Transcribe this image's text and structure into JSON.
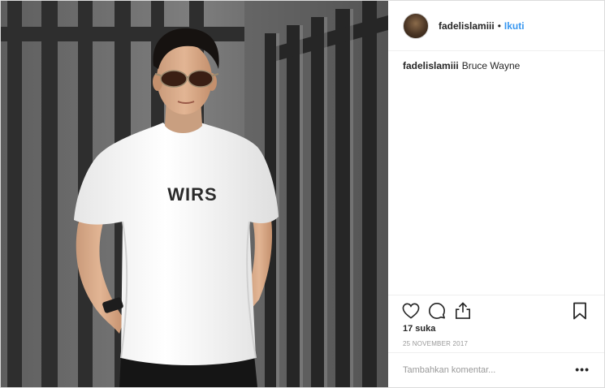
{
  "post": {
    "username": "fadelislamiii",
    "separator": "•",
    "follow_label": "Ikuti",
    "caption_user": "fadelislamiii",
    "caption_text": "Bruce Wayne",
    "likes": "17 suka",
    "date": "25 NOVEMBER 2017",
    "comment_placeholder": "Tambahkan komentar...",
    "more_label": "•••",
    "shirt_print": "WIRS"
  },
  "icons": {
    "like": "heart-icon",
    "comment": "comment-bubble-icon",
    "share": "share-icon",
    "save": "bookmark-icon",
    "options": "more-options-icon"
  },
  "colors": {
    "link": "#3897f0",
    "text": "#262626",
    "muted": "#999999",
    "border": "#efefef"
  }
}
